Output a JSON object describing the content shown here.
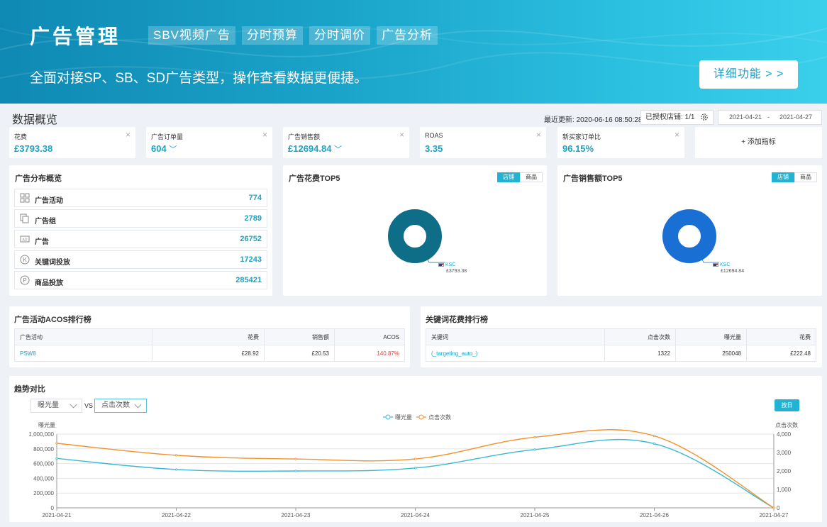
{
  "banner": {
    "title": "广告管理",
    "tags": [
      "SBV视频广告",
      "分时预算",
      "分时调价",
      "广告分析"
    ],
    "subtitle": "全面对接SP、SB、SD广告类型，操作查看数据更便捷。",
    "detail_button": "详细功能 > >"
  },
  "overview": {
    "title": "数据概览",
    "last_updated": "最近更新: 2020-06-16 08:50:28",
    "authorized_shops": "已授权店铺: 1/1",
    "date_start": "2021-04-21",
    "date_sep": "-",
    "date_end": "2021-04-27"
  },
  "kpis": [
    {
      "label": "花费",
      "value": "£3793.38",
      "dropdown": false
    },
    {
      "label": "广告订单量",
      "value": "604",
      "dropdown": true
    },
    {
      "label": "广告销售额",
      "value": "£12694.84",
      "dropdown": true
    },
    {
      "label": "ROAS",
      "value": "3.35",
      "dropdown": false
    },
    {
      "label": "新买家订单比",
      "value": "96.15%",
      "dropdown": false
    }
  ],
  "add_metric": "+ 添加指标",
  "distribution": {
    "title": "广告分布概览",
    "rows": [
      {
        "label": "广告活动",
        "value": "774",
        "icon": "grid-icon"
      },
      {
        "label": "广告组",
        "value": "2789",
        "icon": "copy-icon"
      },
      {
        "label": "广告",
        "value": "26752",
        "icon": "ad-icon"
      },
      {
        "label": "关键词投放",
        "value": "17243",
        "icon": "k-circle-icon"
      },
      {
        "label": "商品投放",
        "value": "285421",
        "icon": "p-circle-icon"
      }
    ]
  },
  "spend_top5": {
    "title": "广告花费TOP5",
    "toggle": [
      "店铺",
      "商品"
    ],
    "shop": "KSC",
    "amount": "£3793.38",
    "color": "#0f6e87"
  },
  "sales_top5": {
    "title": "广告销售额TOP5",
    "toggle": [
      "店铺",
      "商品"
    ],
    "shop": "KSC",
    "amount": "£12694.84",
    "color": "#1a6fd4"
  },
  "acos_table": {
    "title": "广告活动ACOS排行榜",
    "headers": [
      "广告活动",
      "花费",
      "销售额",
      "ACOS"
    ],
    "rows": [
      [
        "PSW8",
        "£28.92",
        "£20.53",
        "140.87%"
      ]
    ]
  },
  "keyword_table": {
    "title": "关键词花费排行榜",
    "headers": [
      "关键词",
      "点击次数",
      "曝光量",
      "花费"
    ],
    "rows": [
      [
        "(_targeting_auto_)",
        "1322",
        "250048",
        "£222.48"
      ]
    ]
  },
  "trend": {
    "title": "趋势对比",
    "metric_a": "曝光量",
    "vs": "VS",
    "metric_b": "点击次数",
    "by_day": "按日"
  },
  "chart_data": {
    "type": "line",
    "x": [
      "2021-04-21",
      "2021-04-22",
      "2021-04-23",
      "2021-04-24",
      "2021-04-25",
      "2021-04-26",
      "2021-04-27"
    ],
    "series": [
      {
        "name": "曝光量",
        "axis": "left",
        "color": "#3bb8d6",
        "values": [
          670000,
          520000,
          500000,
          540000,
          790000,
          870000,
          0
        ]
      },
      {
        "name": "点击次数",
        "axis": "right",
        "color": "#f0922e",
        "values": [
          3500,
          2850,
          2650,
          2650,
          3830,
          3900,
          0
        ]
      }
    ],
    "ylabel_left": "曝光量",
    "ylabel_right": "点击次数",
    "ylim_left": [
      0,
      1000000
    ],
    "ylim_right": [
      0,
      4000
    ],
    "yticks_left": [
      "0",
      "200,000",
      "400,000",
      "600,000",
      "800,000",
      "1,000,000"
    ],
    "yticks_right": [
      "0",
      "1,000",
      "2,000",
      "3,000",
      "4,000"
    ],
    "grid": true,
    "legend": "top-center"
  }
}
